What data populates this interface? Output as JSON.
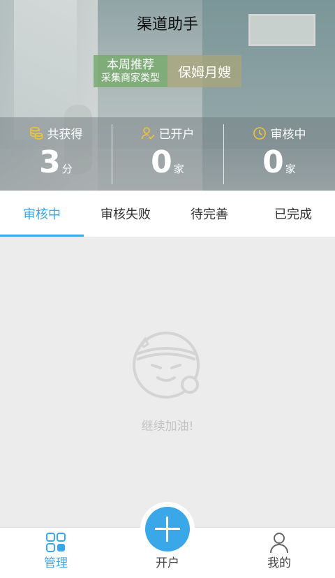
{
  "header": {
    "title": "渠道助手"
  },
  "recommend": {
    "label_line1": "本周推荐",
    "label_line2": "采集商家类型",
    "value": "保姆月嫂"
  },
  "stats": [
    {
      "label": "共获得",
      "value": "3",
      "unit": "分",
      "icon": "coins-icon"
    },
    {
      "label": "已开户",
      "value": "0",
      "unit": "家",
      "icon": "user-check-icon"
    },
    {
      "label": "审核中",
      "value": "0",
      "unit": "家",
      "icon": "clock-icon"
    }
  ],
  "tabs": [
    {
      "label": "审核中",
      "active": true
    },
    {
      "label": "审核失败",
      "active": false
    },
    {
      "label": "待完善",
      "active": false
    },
    {
      "label": "已完成",
      "active": false
    }
  ],
  "empty": {
    "text": "继续加油!",
    "icon": "determined-face-icon"
  },
  "tabbar": {
    "items": [
      {
        "label": "管理",
        "icon": "grid-icon",
        "active": true
      },
      {
        "label": "开户",
        "icon": "plus-icon",
        "active": false
      },
      {
        "label": "我的",
        "icon": "person-icon",
        "active": false
      }
    ]
  },
  "colors": {
    "accent": "#3aa7e8",
    "stat_icon": "#f4c430",
    "recommend_green": "#78aa6e"
  }
}
